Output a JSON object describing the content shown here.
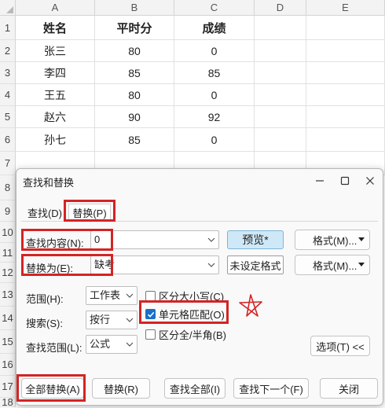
{
  "sheet": {
    "columns": [
      "A",
      "B",
      "C",
      "D",
      "E"
    ],
    "rows": [
      "1",
      "2",
      "3",
      "4",
      "5",
      "6",
      "7",
      "8",
      "9",
      "10",
      "11",
      "12",
      "13",
      "14",
      "15",
      "16",
      "17",
      "18"
    ],
    "headers": [
      "姓名",
      "平时分",
      "成绩"
    ],
    "data": [
      [
        "张三",
        "80",
        "0"
      ],
      [
        "李四",
        "85",
        "85"
      ],
      [
        "王五",
        "80",
        "0"
      ],
      [
        "赵六",
        "90",
        "92"
      ],
      [
        "孙七",
        "85",
        "0"
      ]
    ]
  },
  "dialog": {
    "title": "查找和替换",
    "tabs": {
      "find": "查找(D)",
      "replace": "替换(P)"
    },
    "find_label": "查找内容(N):",
    "find_value": "0",
    "replace_label": "替换为(E):",
    "replace_value": "缺考",
    "preview_label": "预览*",
    "no_format_label": "未设定格式",
    "format_button": "格式(M)...",
    "scope_label": "范围(H):",
    "scope_value": "工作表",
    "search_label": "搜索(S):",
    "search_value": "按行",
    "lookin_label": "查找范围(L):",
    "lookin_value": "公式",
    "match_case": "区分大小写(C)",
    "match_cell": "单元格匹配(O)",
    "match_width": "区分全/半角(B)",
    "options_button": "选项(T) <<",
    "buttons": {
      "replace_all": "全部替换(A)",
      "replace": "替换(R)",
      "find_all": "查找全部(I)",
      "find_next": "查找下一个(F)",
      "close": "关闭"
    }
  },
  "colors": {
    "highlight": "#d32424",
    "checkbox": "#1a6fc7",
    "preview": "#cfe8f7"
  }
}
